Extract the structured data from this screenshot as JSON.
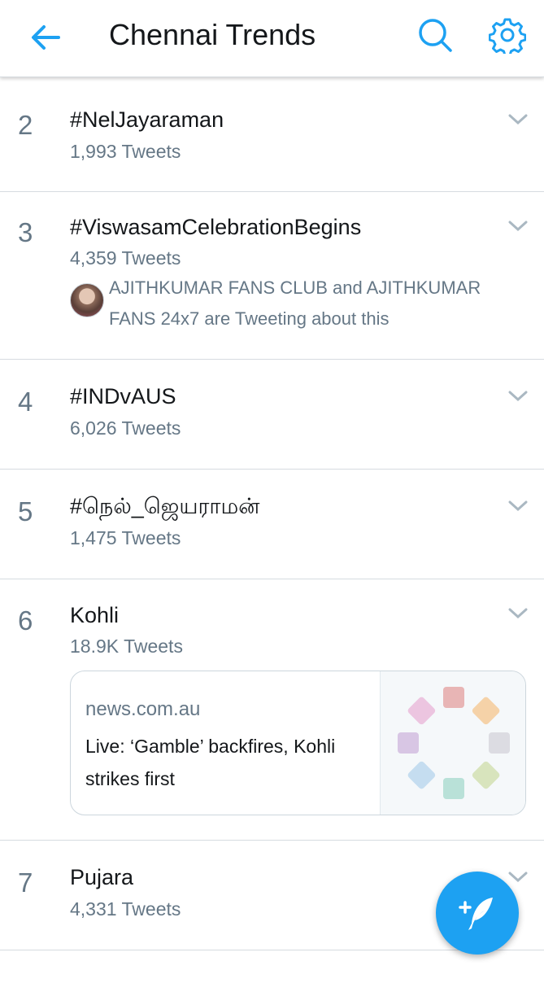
{
  "header": {
    "title": "Chennai Trends",
    "back_icon": "arrow-left-icon",
    "search_icon": "search-icon",
    "settings_icon": "gear-icon",
    "accent_color": "#1da1f2"
  },
  "trends": [
    {
      "rank": "2",
      "name": "#NelJayaraman",
      "tweets": "1,993 Tweets"
    },
    {
      "rank": "3",
      "name": "#ViswasamCelebrationBegins",
      "tweets": "4,359 Tweets",
      "context": "AJITHKUMAR FANS CLUB and AJITHKUMAR FANS 24x7 are Tweeting about this"
    },
    {
      "rank": "4",
      "name": "#INDvAUS",
      "tweets": "6,026 Tweets"
    },
    {
      "rank": "5",
      "name": "#நெல்_ஜெயராமன்",
      "tweets": "1,475 Tweets"
    },
    {
      "rank": "6",
      "name": "Kohli",
      "tweets": "18.9K Tweets",
      "card": {
        "domain": "news.com.au",
        "title": "Live: ‘Gamble’ backfires, Kohli strikes first"
      }
    },
    {
      "rank": "7",
      "name": "Pujara",
      "tweets": "4,331 Tweets"
    }
  ],
  "fab": {
    "icon": "compose-tweet-icon"
  }
}
